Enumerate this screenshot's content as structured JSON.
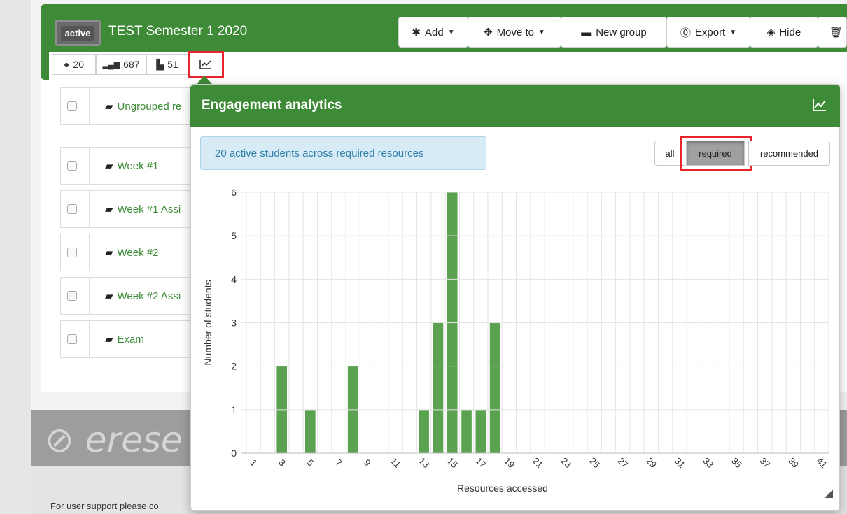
{
  "course": {
    "status_badge": "active",
    "title": "TEST Semester 1 2020"
  },
  "toolbar": {
    "add": "Add",
    "move_to": "Move to",
    "new_group": "New group",
    "export": "Export",
    "hide": "Hide"
  },
  "stats": {
    "students": "20",
    "activity": "687",
    "resources": "51"
  },
  "groups": [
    {
      "label": "Ungrouped re"
    },
    {
      "label": "Week #1"
    },
    {
      "label": "Week #1 Assi"
    },
    {
      "label": "Week #2"
    },
    {
      "label": "Week #2 Assi"
    },
    {
      "label": "Exam"
    }
  ],
  "footer": {
    "logo": "erese",
    "support": "For user support please co"
  },
  "analytics": {
    "title": "Engagement analytics",
    "info": "20 active students across required resources",
    "filters": [
      "all",
      "required",
      "recommended"
    ],
    "selected_filter": "required"
  },
  "colors": {
    "brand": "#3d8b37",
    "bar": "#5aa150",
    "highlight": "#e8232b"
  },
  "chart_data": {
    "type": "bar",
    "xlabel": "Resources accessed",
    "ylabel": "Number of students",
    "ylim": [
      0,
      6
    ],
    "y_ticks": [
      0,
      1,
      2,
      3,
      4,
      5,
      6
    ],
    "categories": [
      1,
      2,
      3,
      4,
      5,
      6,
      7,
      8,
      9,
      10,
      11,
      12,
      13,
      14,
      15,
      16,
      17,
      18,
      19,
      20,
      21,
      22,
      23,
      24,
      25,
      26,
      27,
      28,
      29,
      30,
      31,
      32,
      33,
      34,
      35,
      36,
      37,
      38,
      39,
      40,
      41
    ],
    "x_tick_labels": [
      "1",
      "3",
      "5",
      "7",
      "9",
      "11",
      "13",
      "15",
      "17",
      "19",
      "21",
      "23",
      "25",
      "27",
      "29",
      "31",
      "33",
      "35",
      "37",
      "39",
      "41"
    ],
    "values": [
      0,
      0,
      2,
      0,
      1,
      0,
      0,
      2,
      0,
      0,
      0,
      0,
      1,
      3,
      6,
      1,
      1,
      3,
      0,
      0,
      0,
      0,
      0,
      0,
      0,
      0,
      0,
      0,
      0,
      0,
      0,
      0,
      0,
      0,
      0,
      0,
      0,
      0,
      0,
      0,
      0
    ],
    "grid": true
  }
}
